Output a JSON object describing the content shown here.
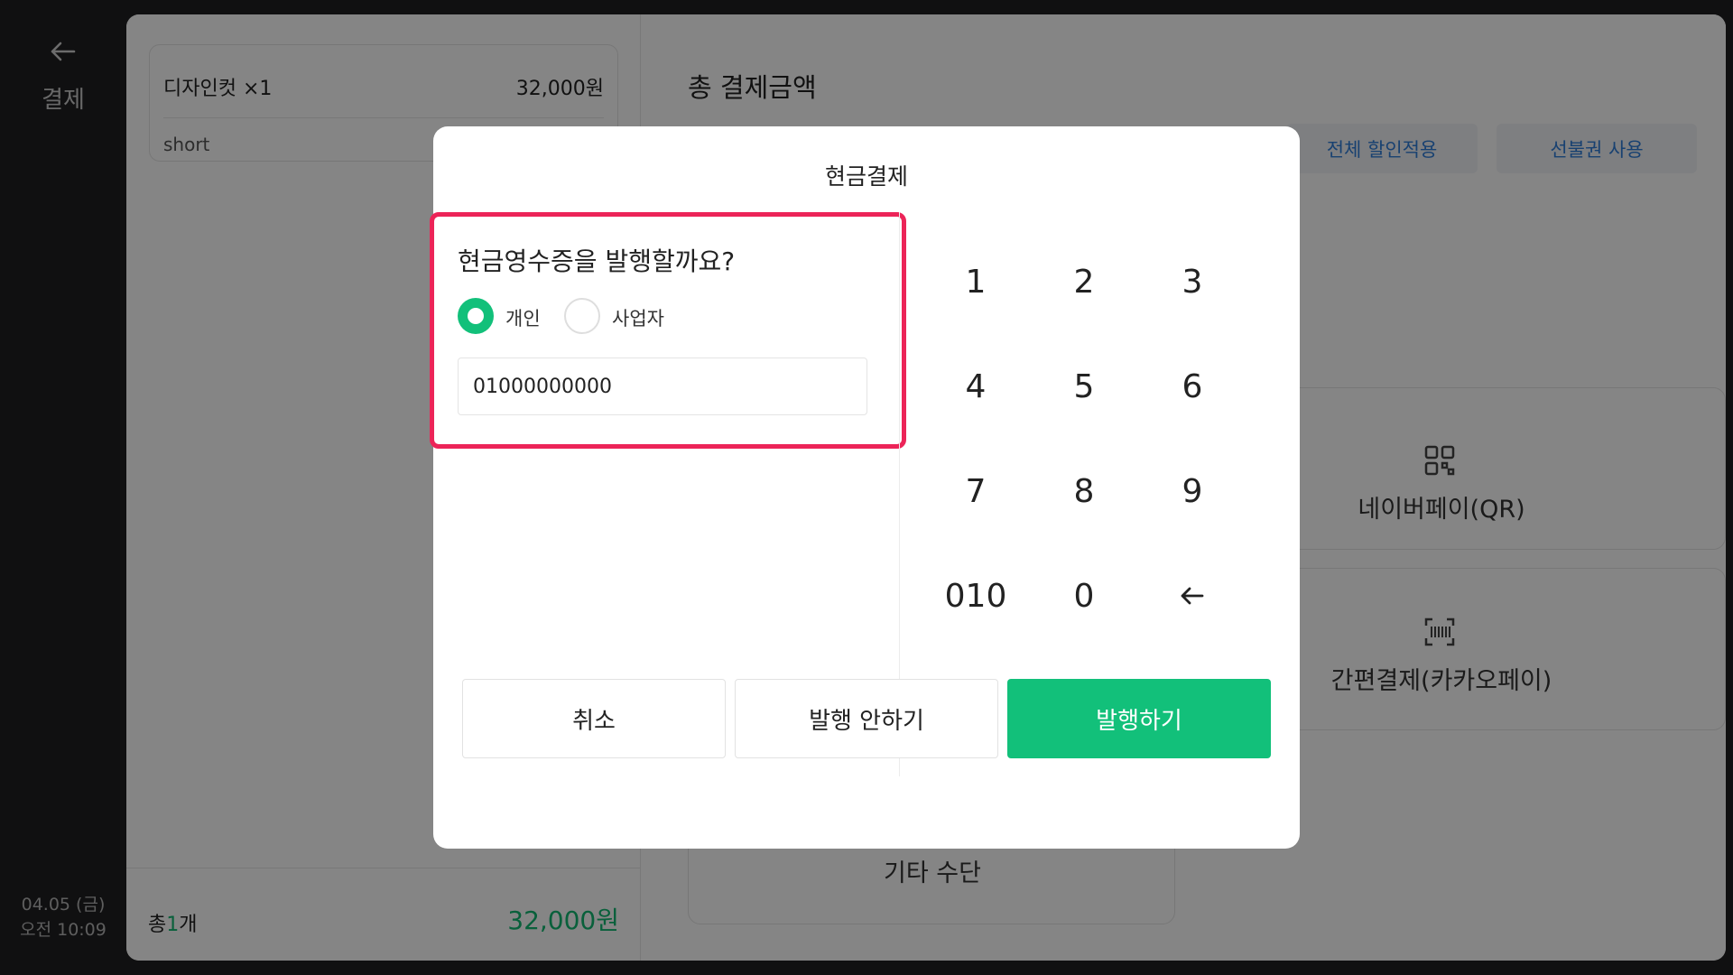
{
  "sidebar": {
    "back_icon": "arrow-left-icon",
    "title": "결제",
    "date": "04.05 (금)",
    "time": "오전 10:09"
  },
  "order": {
    "item_name": "디자인컷 ×1",
    "item_price": "32,000원",
    "item_option": "short",
    "total_prefix": "총",
    "total_count": "1",
    "total_suffix": "개",
    "total_price": "32,000원"
  },
  "payment": {
    "title": "총 결제금액",
    "discount_label": "전체 할인적용",
    "voucher_label": "선불권 사용",
    "methods": [
      {
        "label": "네이버페이(QR)",
        "icon": "qr-code-icon"
      },
      {
        "label": "간편결제(카카오페이)",
        "icon": "barcode-scan-icon"
      }
    ],
    "other_label": "기타 수단"
  },
  "modal": {
    "title": "현금결제",
    "question": "현금영수증을 발행할까요?",
    "options": [
      {
        "label": "개인",
        "selected": true
      },
      {
        "label": "사업자",
        "selected": false
      }
    ],
    "phone_value": "01000000000",
    "keypad": [
      "1",
      "2",
      "3",
      "4",
      "5",
      "6",
      "7",
      "8",
      "9",
      "010",
      "0"
    ],
    "backspace_icon": "backspace-arrow-icon",
    "cancel_label": "취소",
    "no_issue_label": "발행 안하기",
    "issue_label": "발행하기"
  },
  "colors": {
    "accent": "#12c07a",
    "highlight": "#ec2458",
    "link": "#2f7dd8"
  }
}
